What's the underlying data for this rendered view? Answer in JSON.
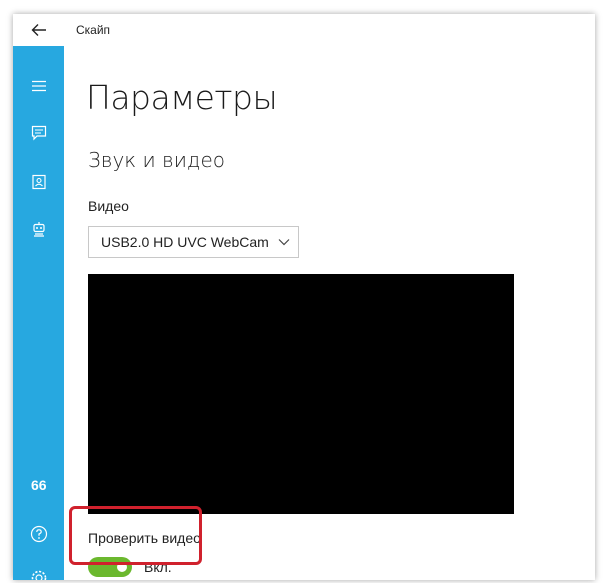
{
  "titlebar": {
    "app_title": "Скайп",
    "back_icon": "arrow-left-icon"
  },
  "sidebar": {
    "items": [
      {
        "icon": "hamburger-menu-icon"
      },
      {
        "icon": "chat-icon"
      },
      {
        "icon": "contacts-icon"
      },
      {
        "icon": "bot-icon"
      },
      {
        "icon": "quote-icon",
        "label": "66"
      },
      {
        "icon": "help-icon"
      },
      {
        "icon": "gear-icon"
      }
    ]
  },
  "main": {
    "page_title": "Параметры",
    "section_title": "Звук и видео",
    "video_label": "Видео",
    "camera_selected": "USB2.0 HD UVC WebCam",
    "test_video_label": "Проверить видео",
    "toggle_state_label": "Вкл.",
    "toggle_on": true
  },
  "colors": {
    "sidebar_bg": "#27a8e0",
    "toggle_on": "#6bb82e",
    "highlight_border": "#d0212d",
    "preview_bg": "#000000"
  }
}
